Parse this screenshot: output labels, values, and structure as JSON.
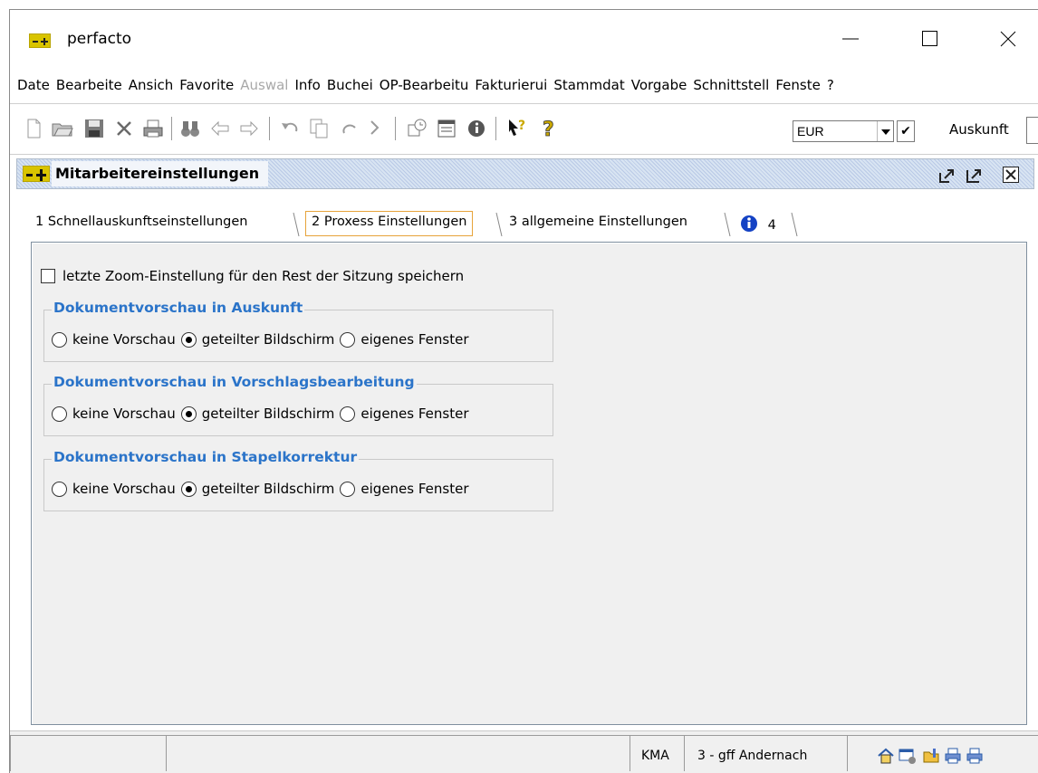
{
  "window": {
    "title": "perfacto"
  },
  "menu": [
    "Date",
    "Bearbeite",
    "Ansich",
    "Favorite",
    "Auswal",
    "Info",
    "Buchei",
    "OP-Bearbeitu",
    "Fakturierui",
    "Stammdat",
    "Vorgabe",
    "Schnittstell",
    "Fenste",
    "?"
  ],
  "menu_disabled": [
    "Auswal"
  ],
  "toolbar": {
    "currency": "EUR",
    "auskunft_label": "Auskunft",
    "icons": [
      "new-document-icon",
      "open-folder-icon",
      "save-icon",
      "delete-icon",
      "print-icon",
      "binoculars-icon",
      "arrow-left-icon",
      "arrow-right-icon",
      "undo-icon",
      "copy-icon",
      "redo-icon",
      "paste-icon",
      "calendar-icon",
      "list-icon",
      "info-icon",
      "help-pointer-icon",
      "help-icon"
    ]
  },
  "inner_window": {
    "title": "Mitarbeitereinstellungen"
  },
  "tabs": [
    {
      "label": "1 Schnellauskunftseinstellungen"
    },
    {
      "label": "2 Proxess Einstellungen",
      "active": true
    },
    {
      "label": "3 allgemeine Einstellungen"
    },
    {
      "label": "4"
    }
  ],
  "settings": {
    "zoom_checkbox_label": "letzte Zoom-Einstellung für den Rest der Sitzung speichern",
    "zoom_checked": false,
    "groups": [
      {
        "title": "Dokumentvorschau in Auskunft",
        "options": [
          "keine Vorschau",
          "geteilter Bildschirm",
          "eigenes Fenster"
        ],
        "selected": "geteilter Bildschirm"
      },
      {
        "title": "Dokumentvorschau in Vorschlagsbearbeitung",
        "options": [
          "keine Vorschau",
          "geteilter Bildschirm",
          "eigenes Fenster"
        ],
        "selected": "geteilter Bildschirm"
      },
      {
        "title": "Dokumentvorschau in Stapelkorrektur",
        "options": [
          "keine Vorschau",
          "geteilter Bildschirm",
          "eigenes Fenster"
        ],
        "selected": "geteilter Bildschirm"
      }
    ]
  },
  "statusbar": {
    "user": "KMA",
    "company": "3 - gff Andernach"
  },
  "colors": {
    "group_title": "#2b74c9",
    "active_tab_border": "#e7a33a",
    "logo": "#d9c400"
  }
}
